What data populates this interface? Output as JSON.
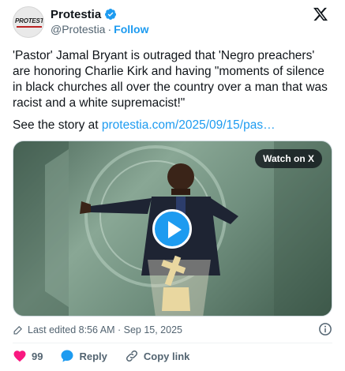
{
  "account": {
    "display_name": "Protestia",
    "handle": "@Protestia",
    "separator": "·",
    "follow_label": "Follow",
    "avatar_text": "PROTESTIA"
  },
  "tweet": {
    "text": "'Pastor' Jamal Bryant is outraged that 'Negro preachers' are honoring Charlie Kirk and having \"moments of silence in black churches all over the country over a man that was racist and a white supremacist!\"",
    "story_prefix": "See the story at ",
    "story_link": "protestia.com/2025/09/15/pas…"
  },
  "media": {
    "watch_label": "Watch on X"
  },
  "meta": {
    "edited_text": "Last edited 8:56 AM · Sep 15, 2025"
  },
  "actions": {
    "like_count": "99",
    "reply_label": "Reply",
    "copy_link_label": "Copy link"
  },
  "colors": {
    "accent": "#1d9bf0",
    "like": "#f91880",
    "muted": "#536471",
    "text": "#0f1419"
  },
  "icons": [
    "verified-icon",
    "x-logo-icon",
    "play-icon",
    "pencil-icon",
    "info-icon",
    "heart-icon",
    "reply-icon",
    "link-icon"
  ]
}
